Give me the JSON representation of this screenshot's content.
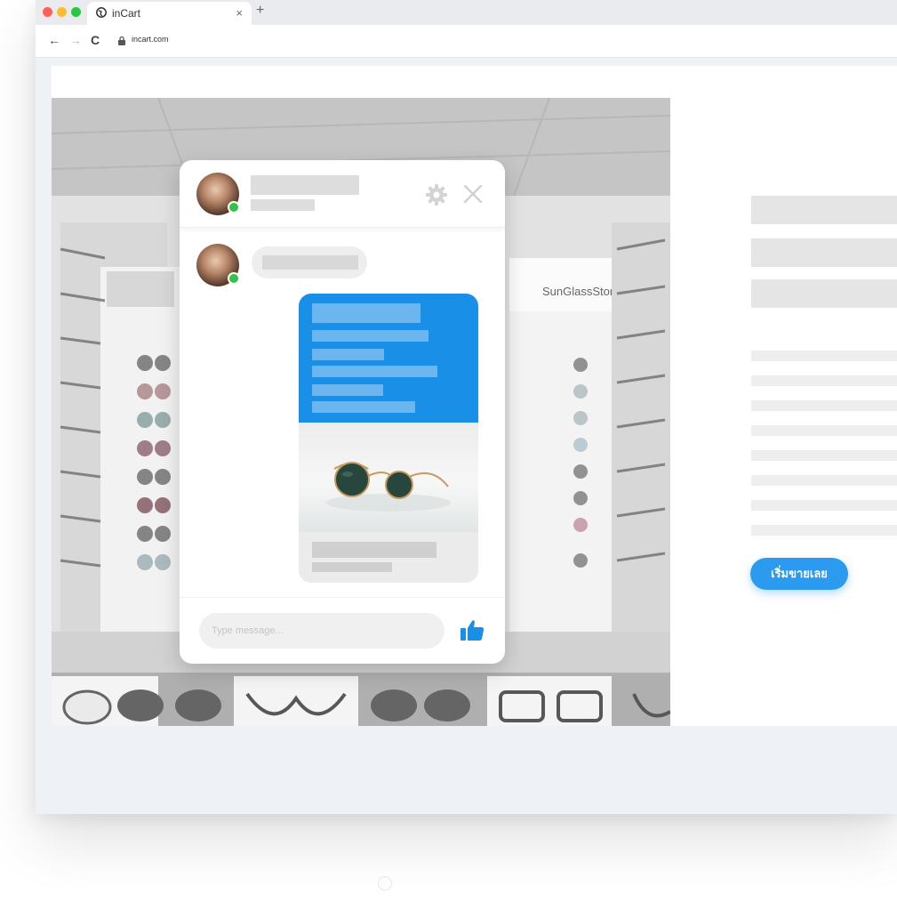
{
  "browser": {
    "tab_title": "inCart",
    "tab_close": "×",
    "new_tab": "+",
    "nav": {
      "back": "←",
      "forward": "→",
      "reload": "C"
    },
    "url": "incart.com"
  },
  "hero": {
    "store_sign": "SunGlassStore"
  },
  "right_panel": {
    "cta_label": "เริ่มขายเลย"
  },
  "chat": {
    "input_placeholder": "Type message..."
  },
  "colors": {
    "accent_blue": "#1a8fe8",
    "cta_blue": "#2c9bef",
    "online_green": "#31c24b"
  },
  "icons": {
    "favicon": "globe-icon",
    "lock": "lock-icon",
    "settings": "gear-icon",
    "close": "close-icon",
    "send": "thumbs-up-icon"
  }
}
